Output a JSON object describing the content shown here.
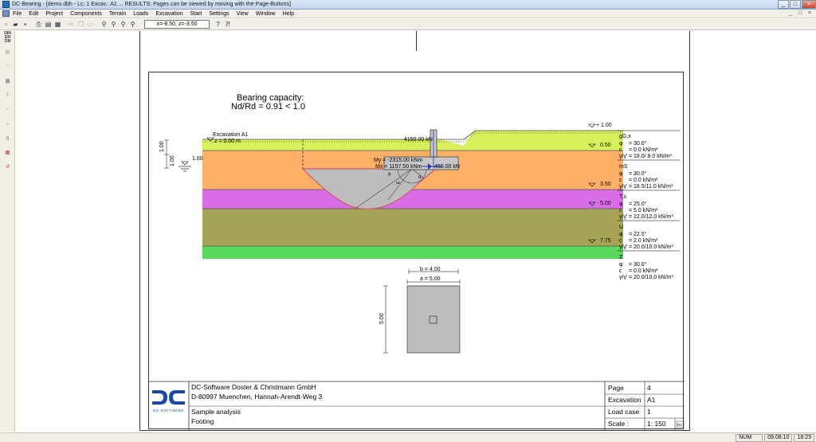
{
  "window": {
    "title": "DC-Bearing - [demo.dbh -  Lc: 1 Excav.: A1 ... RESULTS: Pages can be viewed by moving with the Page-Buttons]",
    "buttons": [
      "_",
      "□",
      "×"
    ]
  },
  "menu": [
    "File",
    "Edit",
    "Project",
    "Components",
    "Terrain",
    "Loads",
    "Excavation",
    "Start",
    "Settings",
    "View",
    "Window",
    "Help"
  ],
  "mdi_buttons": [
    "_",
    "□",
    "×"
  ],
  "toolbar": {
    "coord_display": "x=-8.50, z=-3.50",
    "icons": [
      "new-icon",
      "open-icon",
      "save-icon",
      "print-icon",
      "preview-icon",
      "export-icon",
      "cut-icon",
      "copy-icon",
      "paste-icon",
      "zoom-window-icon",
      "zoom-in-icon",
      "zoom-out-icon",
      "zoom-all-icon",
      "help-icon",
      "context-help-icon"
    ]
  },
  "leftbar": {
    "top_label": "DIN\nEN\nON",
    "icons": [
      "layer-icon",
      "terrain-icon",
      "foundation-icon",
      "load-icon",
      "water-icon",
      "section-icon",
      "results-icon",
      "selected-icon",
      "bearing-icon"
    ]
  },
  "drawing": {
    "heading_line1": "Bearing capacity:",
    "heading_line2": "Nd/Rd =  0.91 < 1.0",
    "excavation_label": "Excavation A1",
    "excavation_level": "z =  0.00 m",
    "dim_100_a": "1.00",
    "dim_100_b": "1.00",
    "water_level": "1.60",
    "load_vertical": "4150.00 kN",
    "load_moment_y": "My = -2315.00 kNm",
    "load_moment_x": "Mx = 1157.50 kNm",
    "load_horizontal": "450.00 kN",
    "angle_alpha": "α",
    "angle_omega": "ω",
    "angle_theta": "ϑ",
    "levels": [
      "+ 1.00",
      "0.50",
      "3.50",
      "5.00",
      "7.75"
    ],
    "layers": [
      {
        "name": "gG,x",
        "phi": "= 30.0°",
        "c": "=  0.0 kN/m²",
        "gamma": "= 18.0/ 8.0 kN/m³",
        "color": "#d9ef5c"
      },
      {
        "name": "mS",
        "phi": "= 30.0°",
        "c": "=  0.0 kN/m²",
        "gamma": "= 18.5/11.0 kN/m³",
        "color": "#ffb068"
      },
      {
        "name": "T,s",
        "phi": "= 25.0°",
        "c": "=  5.0 kN/m²",
        "gamma": "= 22.0/12.0 kN/m³",
        "color": "#d96ee6"
      },
      {
        "name": "U",
        "phi": "= 22.5°",
        "c": "=  2.0 kN/m²",
        "gamma": "= 20.0/10.0 kN/m³",
        "color": "#a7a457"
      },
      {
        "name": "Z",
        "phi": "= 30.0°",
        "c": "=  0.0 kN/m²",
        "gamma": "= 20.0/10.0 kN/m³",
        "color": "#58d95d"
      }
    ],
    "phi_symbol": "φ",
    "c_symbol": "c",
    "gamma_symbol": "γ/γ'",
    "plan_b": "b = 4.00",
    "plan_a": "a = 5.00",
    "plan_dim_side": "5.00"
  },
  "titleblock": {
    "company": "DC-Software Doster & Christmann GmbH",
    "address": "D-80997 Muenchen, Hannah-Arendt-Weg 3",
    "project": "Sample analysis",
    "element": "Footing",
    "logo_caption": "DC·SOFTWARE",
    "page_label": "Page",
    "page_value": "4",
    "excavation_label": "Excavation",
    "excavation_value": "A1",
    "loadcase_label": "Load case",
    "loadcase_value": "1",
    "scale_label": "Scale  :",
    "scale_value": "1:  150",
    "corner_mark": "DC"
  },
  "status": {
    "num": "NUM",
    "date": "09.08.10",
    "time": "18:23"
  }
}
